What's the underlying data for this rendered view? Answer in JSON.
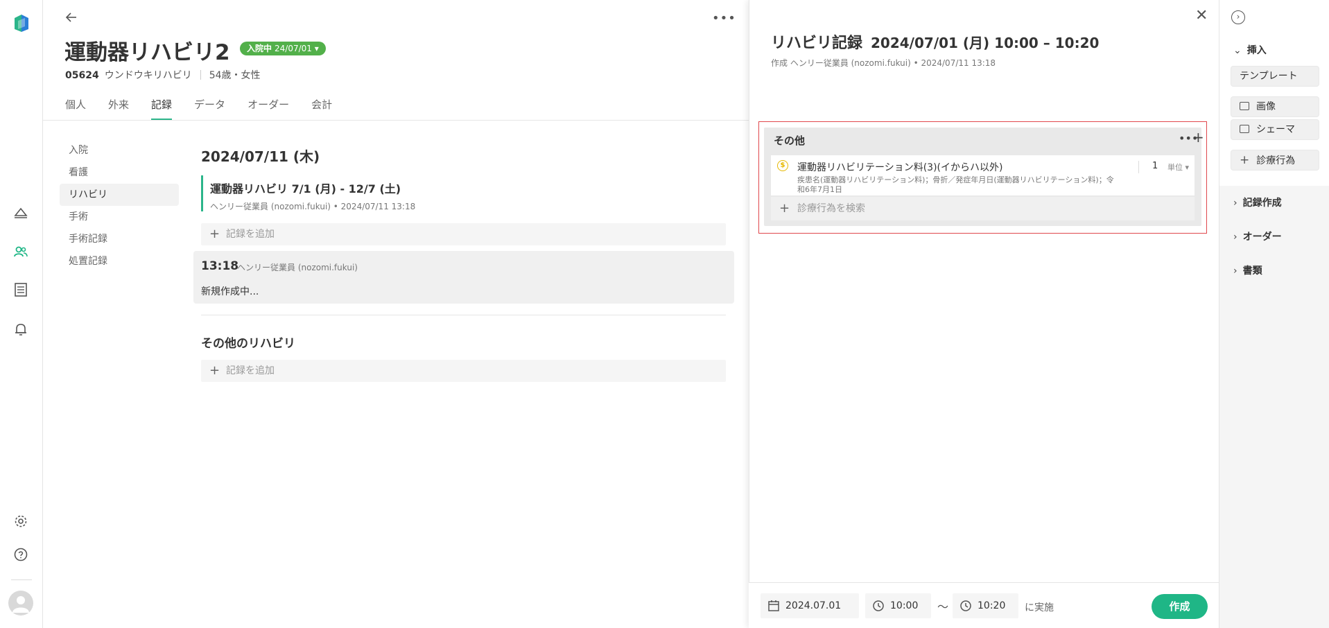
{
  "patient": {
    "name": "運動器リハビリ2",
    "status_label": "入院中",
    "status_date": "24/07/01",
    "id": "05624",
    "kana": "ウンドウキリハビリ",
    "age_sex": "54歳・女性"
  },
  "tabs": [
    {
      "label": "個人"
    },
    {
      "label": "外来"
    },
    {
      "label": "記録"
    },
    {
      "label": "データ"
    },
    {
      "label": "オーダー"
    },
    {
      "label": "会計"
    }
  ],
  "sub_nav": [
    {
      "label": "入院"
    },
    {
      "label": "看護"
    },
    {
      "label": "リハビリ"
    },
    {
      "label": "手術"
    },
    {
      "label": "手術記録"
    },
    {
      "label": "処置記録"
    }
  ],
  "records": {
    "date_heading": "2024/07/11 (木)",
    "rehab_title": "運動器リハビリ  7/1 (月) - 12/7 (土)",
    "rehab_sub": "ヘンリー従業員 (nozomi.fukui) • 2024/07/11 13:18",
    "add_record": "記録を追加",
    "draft_time": "13:18",
    "draft_author": "ヘンリー従業員 (nozomi.fukui)",
    "draft_status": "新規作成中...",
    "other_title": "その他のリハビリ",
    "other_add": "記録を追加"
  },
  "modal": {
    "title": "リハビリ記録",
    "datetime": "2024/07/01 (月) 10:00 – 10:20",
    "sub": "作成 ヘンリー従業員 (nozomi.fukui) • 2024/07/11 13:18",
    "section_title": "その他",
    "procedure_name": "運動器リハビリテーション料(3)(イからハ以外)",
    "procedure_detail": "疾患名(運動器リハビリテーション料)；骨折／発症年月日(運動器リハビリテーション料)；令和6年7月1日",
    "qty": "1",
    "unit": "単位",
    "search_placeholder": "診療行為を検索",
    "date": "2024.07.01",
    "start_time": "10:00",
    "tilde": "〜",
    "end_time": "10:20",
    "suffix": "に実施",
    "create_label": "作成"
  },
  "insert_panel": {
    "insert_heading": "挿入",
    "template_label": "テンプレート",
    "image_label": "画像",
    "schema_label": "シェーマ",
    "procedure_label": "診療行為",
    "record_create": "記録作成",
    "order": "オーダー",
    "documents": "書類"
  },
  "colors": {
    "accent": "#1fb686",
    "status_badge": "#52b04a",
    "highlight_border": "#e0474c"
  }
}
